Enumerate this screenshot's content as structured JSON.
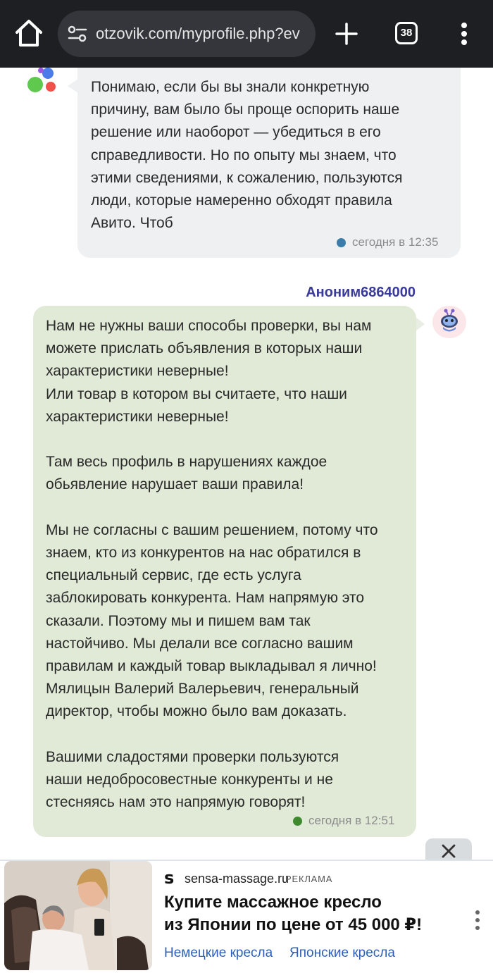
{
  "browser": {
    "url": "otzovik.com/myprofile.php?ev",
    "tab_count": "38"
  },
  "support_message": {
    "text": "Понимаю, если бы вы знали конкретную\nпричину, вам было бы проще оспорить наше\nрешение или наоборот — убедиться в его\nсправедливости. Но по опыту мы знаем, что\nэтими сведениями, к сожалению, пользуются\nлюди, которые намеренно обходят правила\nАвито. Чтоб",
    "time": "сегодня в 12:35",
    "status_color": "#3a7dab"
  },
  "user_message": {
    "author": "Аноним6864000",
    "text": "Нам не нужны ваши способы проверки, вы нам\nможете прислать объявления в которых наши\nхарактеристики неверные!\nИли товар в котором вы считаете, что наши\nхарактеристики неверные!\n\nТам весь профиль в нарушениях каждое\nобьявление нарушает ваши правила!\n\nМы не согласны с вашим решением, потому что\nзнаем, кто из конкурентов на нас обратился в\nспециальный сервис, где есть услуга\nзаблокировать конкурента. Нам напрямую это\nсказали. Поэтому мы и пишем вам так\nнастойчиво. Мы делали все согласно вашим\nправилам и каждый товар выкладывал я лично!\nМялицын Валерий Валерьевич, генеральный\nдиректор, чтобы можно было вам доказать.\n\nВашими сладостями проверки пользуются\nнаши недобросовестные конкуренты и не\nстесняясь нам это напрямую говорят!",
    "time": "сегодня в 12:51",
    "status_color": "#3f8a2f"
  },
  "ad": {
    "domain_logo": "s",
    "domain": "sensa-massage.ru",
    "label": "РЕКЛАМА",
    "title_line1": "Купите массажное кресло",
    "title_line2": "из Японии по цене от 45 000 ₽!",
    "link1": "Немецкие кресла",
    "link2": "Японские кресла"
  },
  "colors": {
    "author": "#3a3a9a",
    "ad_link": "#2d5fb8",
    "user_bubble": "#e1ead6",
    "support_bubble": "#eff0f1"
  }
}
